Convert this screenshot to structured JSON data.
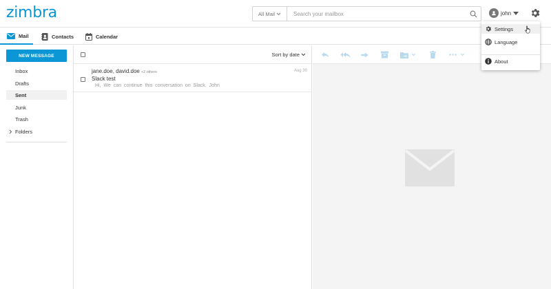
{
  "header": {
    "logo": "zimbra",
    "search_scope": "All Mail",
    "search_placeholder": "Search your mailbox",
    "user_name": "john"
  },
  "nav": {
    "tabs": [
      {
        "label": "Mail",
        "icon": "mail-icon",
        "active": true
      },
      {
        "label": "Contacts",
        "icon": "contacts-icon"
      },
      {
        "label": "Calendar",
        "icon": "calendar-icon"
      }
    ]
  },
  "sidebar": {
    "new_message": "NEW MESSAGE",
    "folders": [
      "Inbox",
      "Drafts",
      "Sent",
      "Junk",
      "Trash"
    ],
    "active_folder": "Sent",
    "folders_label": "Folders"
  },
  "list": {
    "sort_label": "Sort by date",
    "messages": [
      {
        "from": "jane.doe, david.doe",
        "others": "+2 others",
        "subject": "Slack test",
        "snippet": "Hi, We can continue this conversation on Slack. John",
        "date": "Aug 30"
      }
    ]
  },
  "menu": {
    "items": [
      {
        "label": "Settings",
        "icon": "gear-icon"
      },
      {
        "label": "Language",
        "icon": "globe-icon"
      },
      {
        "label": "About",
        "icon": "info-icon"
      }
    ]
  },
  "colors": {
    "accent": "#0b96d6",
    "toolbar_icon": "#b9d9ef",
    "pane_bg": "#f4f4f4"
  }
}
